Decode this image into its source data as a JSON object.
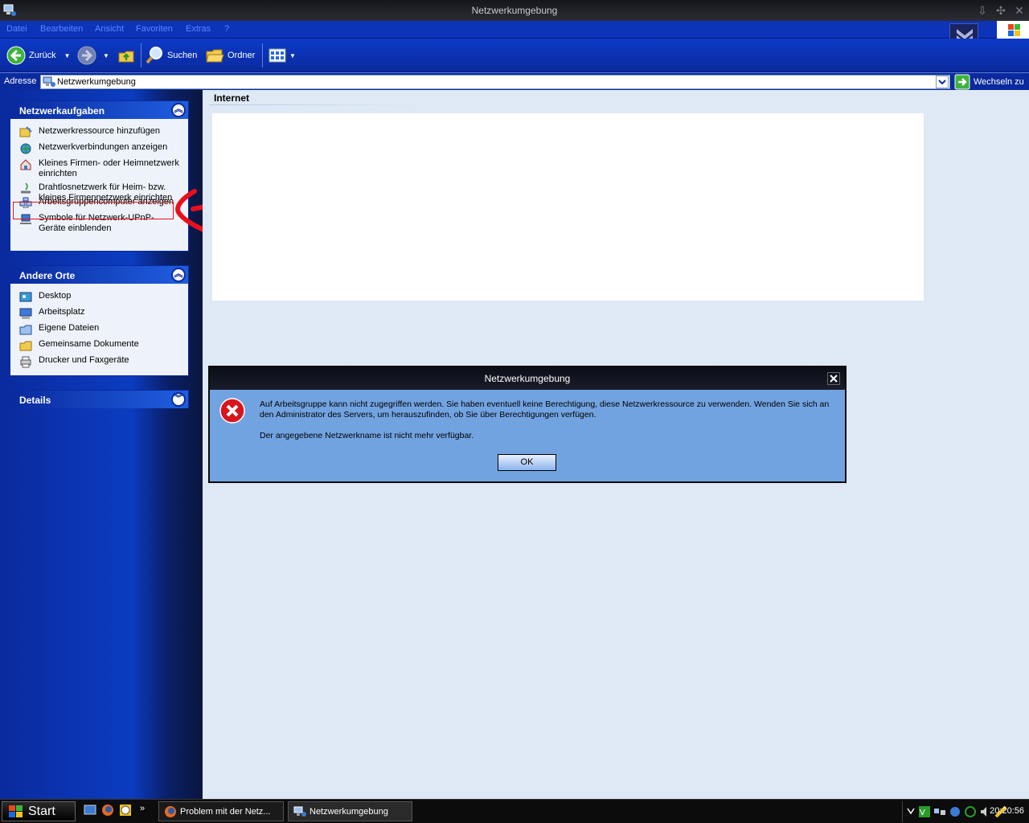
{
  "window": {
    "title": "Netzwerkumgebung"
  },
  "menu": {
    "items": [
      "Datei",
      "Bearbeiten",
      "Ansicht",
      "Favoriten",
      "Extras",
      "?"
    ]
  },
  "toolbar": {
    "back_label": "Zurück",
    "search_label": "Suchen",
    "folders_label": "Ordner"
  },
  "address": {
    "label": "Adresse",
    "value": "Netzwerkumgebung",
    "go_label": "Wechseln zu"
  },
  "sidebar": {
    "network_tasks": {
      "title": "Netzwerkaufgaben",
      "items": [
        "Netzwerkressource hinzufügen",
        "Netzwerkverbindungen anzeigen",
        "Kleines Firmen- oder Heimnetzwerk einrichten",
        "Drahtlosnetzwerk für Heim- bzw. kleines Firmennetzwerk einrichten",
        "Arbeitsgruppencomputer anzeigen",
        "Symbole für Netzwerk-UPnP-Geräte einblenden"
      ]
    },
    "other_places": {
      "title": "Andere Orte",
      "items": [
        "Desktop",
        "Arbeitsplatz",
        "Eigene Dateien",
        "Gemeinsame Dokumente",
        "Drucker und Faxgeräte"
      ]
    },
    "details": {
      "title": "Details"
    }
  },
  "content": {
    "group_title": "Internet"
  },
  "dialog": {
    "title": "Netzwerkumgebung",
    "message": "Auf Arbeitsgruppe kann nicht zugegriffen werden. Sie haben eventuell keine Berechtigung, diese Netzwerkressource zu verwenden. Wenden Sie sich an den Administrator des Servers, um herauszufinden, ob Sie über Berechtigungen verfügen.",
    "detail": "Der angegebene Netzwerkname ist nicht mehr verfügbar.",
    "ok_label": "OK"
  },
  "taskbar": {
    "start_label": "Start",
    "tasks": [
      "Problem mit der Netz...",
      "Netzwerkumgebung"
    ],
    "clock": "20:20:56"
  },
  "colors": {
    "accent": "#0c33b8",
    "dialog_bg": "#72a3e1",
    "annotation": "#e8101c"
  }
}
